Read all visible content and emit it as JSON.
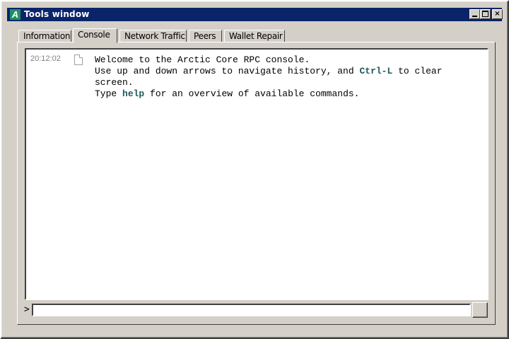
{
  "window": {
    "app_icon_letter": "A",
    "title": "Tools window",
    "minimize_glyph": "",
    "maximize_glyph": "",
    "close_glyph": "×"
  },
  "tabs": [
    {
      "label": "Information",
      "active": false
    },
    {
      "label": "Console",
      "active": true
    },
    {
      "label": "Network Traffic",
      "active": false
    },
    {
      "label": "Peers",
      "active": false
    },
    {
      "label": "Wallet Repair",
      "active": false
    }
  ],
  "console": {
    "entries": [
      {
        "timestamp": "20:12:02",
        "icon": "document-icon",
        "line1": "Welcome to the Arctic Core RPC console.",
        "line2_pre": "Use up and down arrows to navigate history, and ",
        "line2_kw": "Ctrl-L",
        "line2_post": " to clear",
        "line3": "screen.",
        "line4_pre": "Type ",
        "line4_kw": "help",
        "line4_post": " for an overview of available commands."
      }
    ],
    "prompt_symbol": ">",
    "input_value": "",
    "input_placeholder": ""
  },
  "colors": {
    "titlebar": "#0a246a",
    "face": "#d4d0c8",
    "keyword": "#1f5a5a",
    "timestamp": "#808080"
  }
}
